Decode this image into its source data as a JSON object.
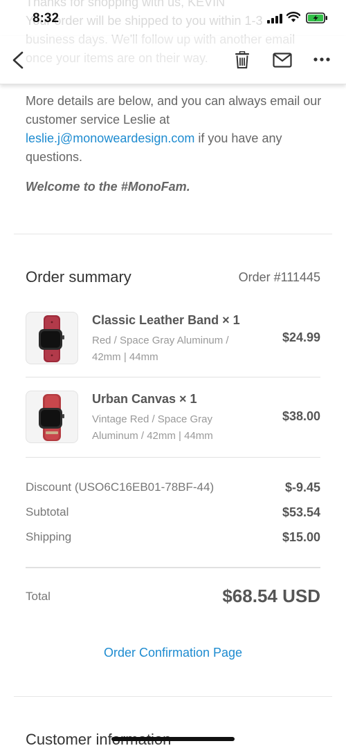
{
  "status_bar": {
    "time": "8:32"
  },
  "ghost_text": {
    "line1": "Thanks for shopping with us, KEVIN",
    "line2": "Your order will be shipped to you within 1-3",
    "line3": "business days. We'll follow up with another email",
    "line4": "once your items are on their way."
  },
  "toolbar": {
    "back_icon": "chevron-left-icon",
    "trash_icon": "trash-icon",
    "mail_icon": "mail-icon",
    "more_icon": "more-horizontal-icon"
  },
  "intro": {
    "text_before": "More details are below, and you can always email our customer service Leslie at ",
    "email": "leslie.j@monoweardesign.com",
    "text_after": " if you have any questions.",
    "welcome": "Welcome to the #MonoFam."
  },
  "order": {
    "title": "Order summary",
    "number": "Order #111445",
    "items": [
      {
        "name": "Classic Leather Band × 1",
        "variant": "Red / Space Gray Aluminum / 42mm | 44mm",
        "price": "$24.99"
      },
      {
        "name": "Urban Canvas × 1",
        "variant": "Vintage Red / Space Gray Aluminum / 42mm | 44mm",
        "price": "$38.00"
      }
    ],
    "discount_label": "Discount (USO6C16EB01-78BF-44)",
    "discount_value": "$-9.45",
    "subtotal_label": "Subtotal",
    "subtotal_value": "$53.54",
    "shipping_label": "Shipping",
    "shipping_value": "$15.00",
    "total_label": "Total",
    "total_value": "$68.54 USD",
    "confirmation_link": "Order Confirmation Page"
  },
  "customer": {
    "title": "Customer information"
  },
  "colors": {
    "link": "#1d8bd0",
    "band_red": "#9e2a3a",
    "canvas_red": "#b23a3f"
  }
}
